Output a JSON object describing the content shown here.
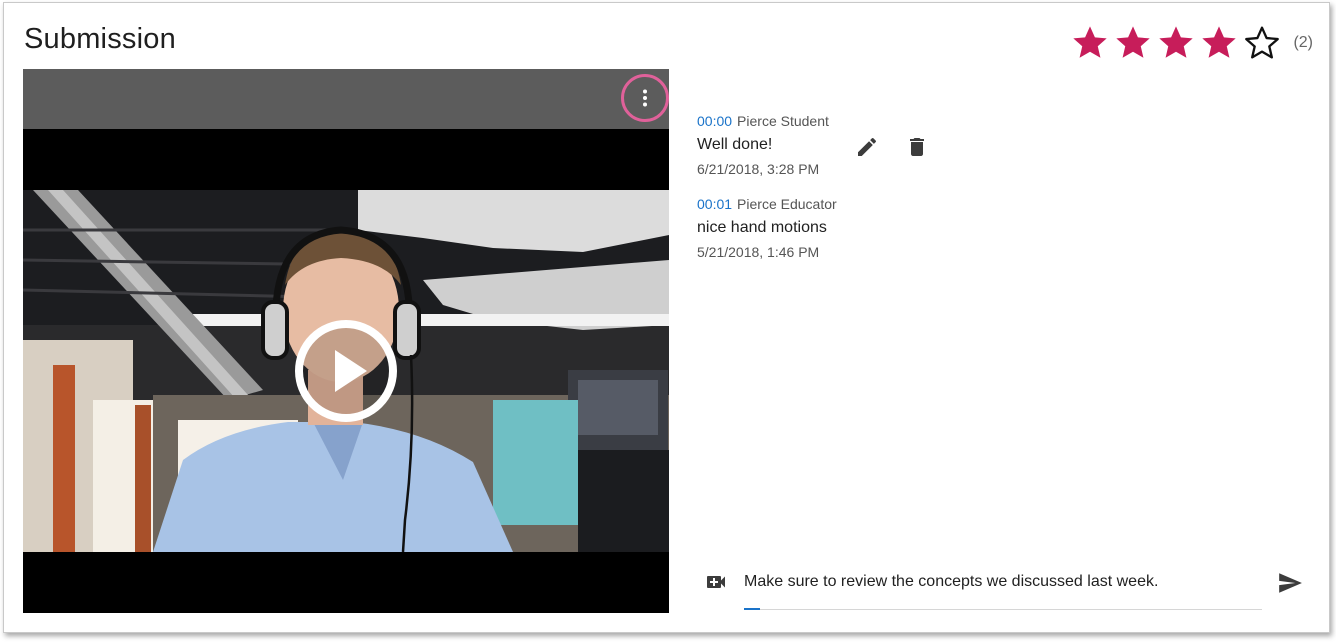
{
  "header": {
    "title": "Submission"
  },
  "rating": {
    "value": 4,
    "max": 5,
    "count": "(2)",
    "filled_color": "#c71d5a",
    "empty_color": "#111111"
  },
  "video": {
    "menu_icon": "more-vert-icon",
    "play_icon": "play-icon",
    "highlight_color": "#e0619a"
  },
  "comments": [
    {
      "time": "00:00",
      "author": "Pierce Student",
      "text": "Well done!",
      "date": "6/21/2018, 3:28 PM",
      "actions": [
        "edit-icon",
        "delete-icon"
      ]
    },
    {
      "time": "00:01",
      "author": "Pierce Educator",
      "text": "nice hand motions",
      "date": "5/21/2018, 1:46 PM"
    }
  ],
  "composer": {
    "value": "Make sure to review the concepts we discussed last week.",
    "video_icon": "video-camera-plus-icon",
    "send_icon": "send-icon"
  },
  "colors": {
    "accent": "#1a73c9"
  }
}
